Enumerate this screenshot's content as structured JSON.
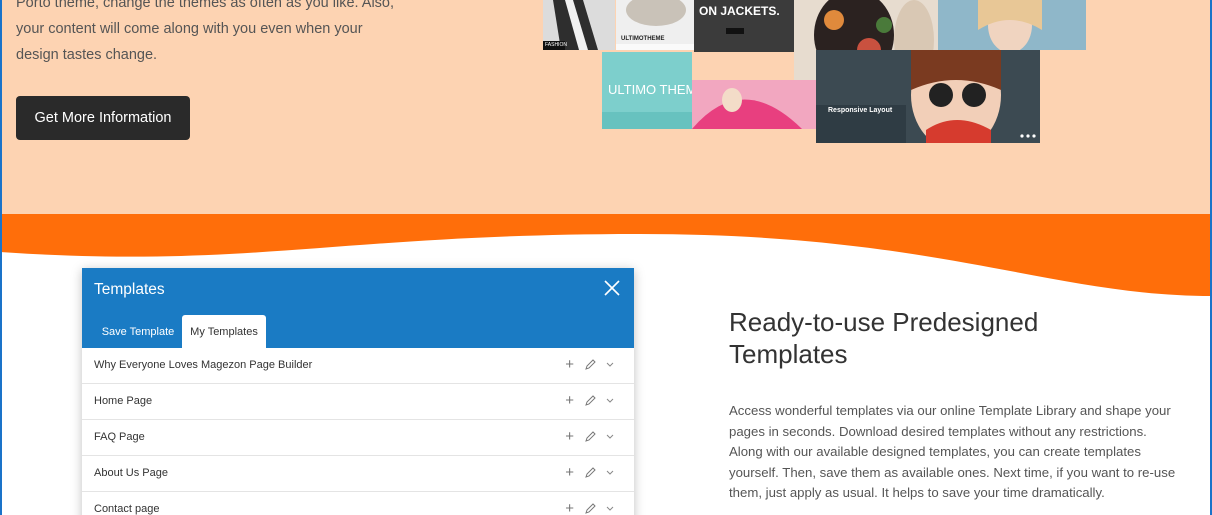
{
  "hero": {
    "text_lines": [
      "Porto theme, change the themes as often as you like. Also,",
      "your content will come along with you even when your",
      "design tastes change."
    ],
    "cta_label": "Get More Information",
    "collage": {
      "headline": "ON JACKETS.",
      "brand": "ULTIMOTHEME",
      "brand_big": "ULTIMO THEME",
      "badge": "FASHION",
      "caption": "Responsive Layout"
    }
  },
  "templates_dialog": {
    "title": "Templates",
    "tabs": [
      {
        "label": "Save Template",
        "active": false
      },
      {
        "label": "My Templates",
        "active": true
      }
    ],
    "rows": [
      {
        "label": "Why Everyone Loves Magezon Page Builder"
      },
      {
        "label": "Home Page"
      },
      {
        "label": "FAQ Page"
      },
      {
        "label": "About Us Page"
      },
      {
        "label": "Contact page"
      }
    ],
    "row_actions": [
      "plus-icon",
      "pencil-icon",
      "chevron-down-icon"
    ]
  },
  "feature": {
    "title_lines": [
      "Ready-to-use Predesigned",
      "Templates"
    ],
    "text_lines": [
      "Access wonderful templates via our online Template Library and shape your",
      "pages in seconds. Download desired templates without any restrictions.",
      "Along with our available designed templates, you can create templates",
      "yourself. Then, save them as available ones. Next time, if you want to re-use",
      "them, just apply as usual. It helps to save your time dramatically."
    ]
  },
  "colors": {
    "hero_bg": "#fdd3b2",
    "wave_orange": "#ff6e0a",
    "dialog_blue": "#1a7bc4",
    "button_dark": "#2a2a2a"
  }
}
